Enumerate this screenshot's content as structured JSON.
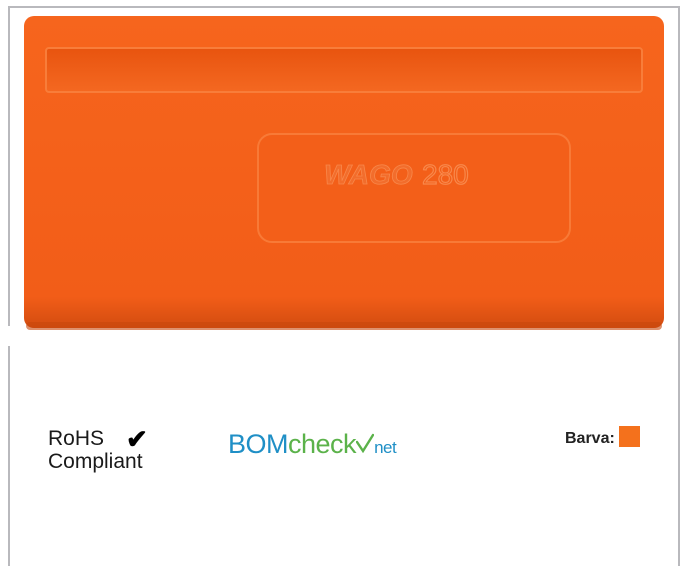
{
  "product": {
    "logo_text": "WAGO",
    "model_number": "280",
    "body_color": "#f4611c"
  },
  "compliance": {
    "rohs_line1": "RoHS",
    "rohs_line2": "Compliant",
    "rohs_check_icon": "checkmark-icon"
  },
  "bomcheck": {
    "part1": "BOM",
    "part2": "check",
    "part3": "net"
  },
  "color_label": {
    "label": "Barva:",
    "swatch_color": "#f4711c"
  }
}
